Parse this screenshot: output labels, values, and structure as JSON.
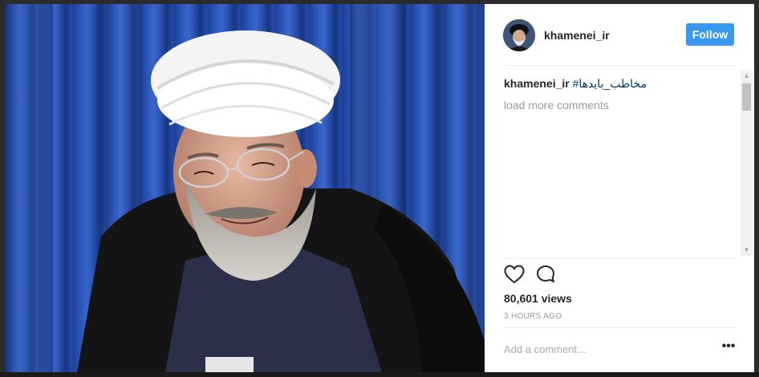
{
  "post": {
    "username": "khamenei_ir",
    "follow_label": "Follow",
    "caption_author": "khamenei_ir",
    "caption_hashtag": "#مخاطب_بایدها",
    "load_more_label": "load more comments",
    "views": "80,601 views",
    "time_ago": "3 HOURS AGO",
    "comment_placeholder": "Add a comment...",
    "more_label": "•••"
  },
  "icons": {
    "like": "heart-outline-icon",
    "comment": "speech-bubble-icon",
    "more": "ellipsis-icon"
  },
  "colors": {
    "follow_button": "#3897f0",
    "hashtag": "#003569",
    "secondary_text": "#999999",
    "curtain_blue": "#2a54b8"
  },
  "scrollbar": {
    "position": 0
  }
}
